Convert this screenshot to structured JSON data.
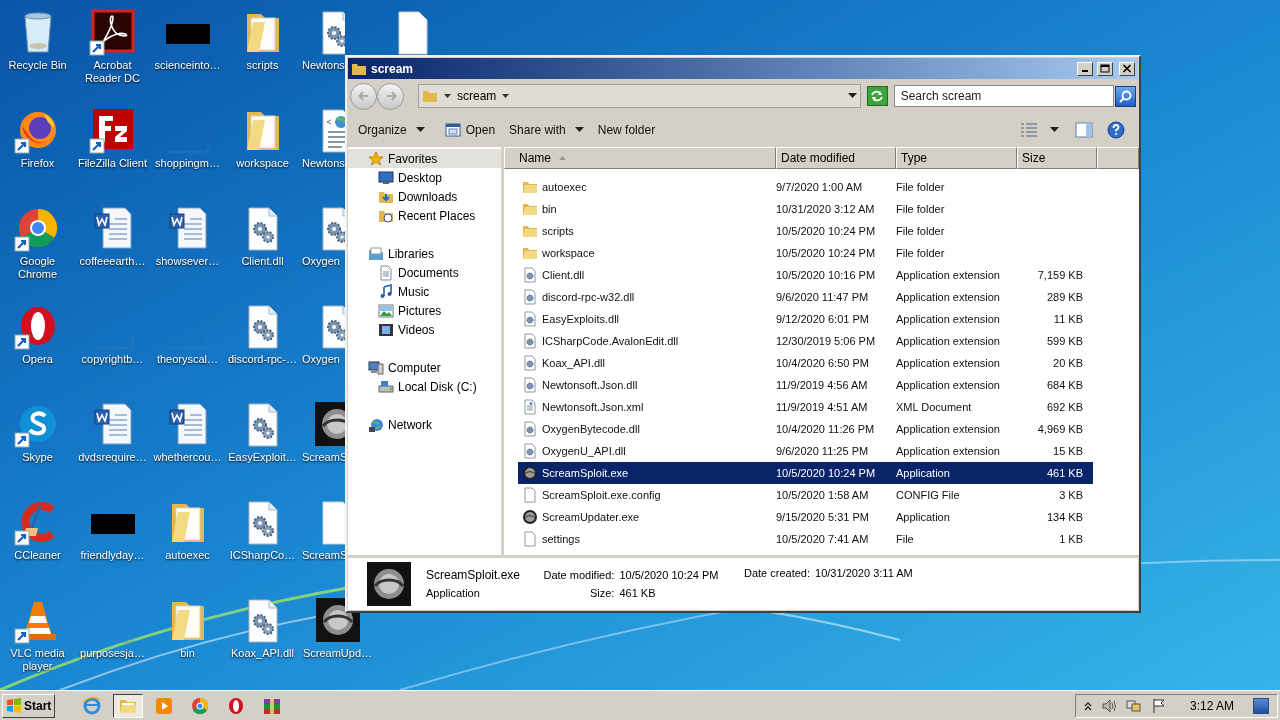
{
  "desktop": {
    "icons": [
      {
        "label": "Recycle Bin",
        "kind": "recycle",
        "shortcut": false
      },
      {
        "label": "Firefox",
        "kind": "firefox",
        "shortcut": true
      },
      {
        "label": "Google Chrome",
        "kind": "chrome",
        "shortcut": true
      },
      {
        "label": "Opera",
        "kind": "opera",
        "shortcut": true
      },
      {
        "label": "Skype",
        "kind": "skype",
        "shortcut": true
      },
      {
        "label": "CCleaner",
        "kind": "ccleaner",
        "shortcut": true
      },
      {
        "label": "VLC media player",
        "kind": "vlc",
        "shortcut": true
      },
      {
        "label": "Acrobat Reader DC",
        "kind": "acrobat",
        "shortcut": true
      },
      {
        "label": "FileZilla Client",
        "kind": "filezilla",
        "shortcut": true
      },
      {
        "label": "coffeeearth…",
        "kind": "word",
        "shortcut": false
      },
      {
        "label": "copyrightb…",
        "kind": "blank",
        "shortcut": false
      },
      {
        "label": "dvdsrequire…",
        "kind": "word",
        "shortcut": false
      },
      {
        "label": "friendlyday…",
        "kind": "redacted",
        "shortcut": false
      },
      {
        "label": "purposesja…",
        "kind": "blank",
        "shortcut": false
      },
      {
        "label": "scienceinto…",
        "kind": "redacted",
        "shortcut": false
      },
      {
        "label": "shoppingm…",
        "kind": "blank",
        "shortcut": false
      },
      {
        "label": "showsever…",
        "kind": "word",
        "shortcut": false
      },
      {
        "label": "theoryscal…",
        "kind": "blank",
        "shortcut": false
      },
      {
        "label": "whethercou…",
        "kind": "word",
        "shortcut": false
      },
      {
        "label": "autoexec",
        "kind": "folder",
        "shortcut": false
      },
      {
        "label": "bin",
        "kind": "folder",
        "shortcut": false
      },
      {
        "label": "scripts",
        "kind": "folder",
        "shortcut": false
      },
      {
        "label": "workspace",
        "kind": "folder",
        "shortcut": false
      },
      {
        "label": "Client.dll",
        "kind": "gear",
        "shortcut": false
      },
      {
        "label": "discord-rpc-…",
        "kind": "gear",
        "shortcut": false
      },
      {
        "label": "EasyExploit…",
        "kind": "gear",
        "shortcut": false
      },
      {
        "label": "ICSharpCo…",
        "kind": "gear",
        "shortcut": false
      },
      {
        "label": "Koax_API.dll",
        "kind": "gear",
        "shortcut": false
      },
      {
        "label": "Newtons",
        "kind": "gear",
        "shortcut": false
      },
      {
        "label": "Newtons",
        "kind": "xml",
        "shortcut": false
      },
      {
        "label": "Oxygen",
        "kind": "gear",
        "shortcut": false
      },
      {
        "label": "Oxygen",
        "kind": "gear",
        "shortcut": false
      },
      {
        "label": "ScreamS",
        "kind": "scream",
        "shortcut": false
      },
      {
        "label": "ScreamS",
        "kind": "page",
        "shortcut": false
      },
      {
        "label": "ScreamUpd…",
        "kind": "scream",
        "shortcut": false
      },
      {
        "kind": "page",
        "shortcut": false
      }
    ]
  },
  "window": {
    "title": "scream",
    "address": "scream",
    "search": {
      "placeholder": "Search scream"
    },
    "toolbar": [
      {
        "label": "Organize",
        "kind": "plain",
        "dropdown": true
      },
      {
        "label": "Open",
        "kind": "with-icon",
        "dropdown": false
      },
      {
        "label": "Share with",
        "kind": "plain",
        "dropdown": true
      },
      {
        "label": "New folder",
        "kind": "plain",
        "dropdown": false
      }
    ],
    "nav": [
      {
        "label": "Favorites",
        "kind": "star",
        "selected": true,
        "children": [
          {
            "label": "Desktop",
            "kind": "desktop",
            "selected": false
          },
          {
            "label": "Downloads",
            "kind": "downloads",
            "selected": false
          },
          {
            "label": "Recent Places",
            "kind": "recent",
            "selected": false
          }
        ]
      },
      {
        "label": "Libraries",
        "kind": "library",
        "selected": false,
        "children": [
          {
            "label": "Documents",
            "kind": "documents",
            "selected": false
          },
          {
            "label": "Music",
            "kind": "music",
            "selected": false
          },
          {
            "label": "Pictures",
            "kind": "pictures",
            "selected": false
          },
          {
            "label": "Videos",
            "kind": "videos",
            "selected": false
          }
        ]
      },
      {
        "label": "Computer",
        "kind": "computer",
        "selected": false,
        "children": [
          {
            "label": "Local Disk (C:)",
            "kind": "disk",
            "selected": false
          }
        ]
      },
      {
        "label": "Network",
        "kind": "network",
        "selected": false
      }
    ],
    "columns": [
      {
        "label": "Name",
        "sorted": true
      },
      {
        "label": "Date modified",
        "sorted": false
      },
      {
        "label": "Type",
        "sorted": false
      },
      {
        "label": "Size",
        "sorted": false
      }
    ],
    "rows": [
      {
        "name": "autoexec",
        "date": "9/7/2020 1:00 AM",
        "type": "File folder",
        "kind": "folder",
        "selected": false
      },
      {
        "name": "bin",
        "date": "10/31/2020 3:12 AM",
        "type": "File folder",
        "kind": "folder",
        "selected": false
      },
      {
        "name": "scripts",
        "date": "10/5/2020 10:24 PM",
        "type": "File folder",
        "kind": "folder",
        "selected": false
      },
      {
        "name": "workspace",
        "date": "10/5/2020 10:24 PM",
        "type": "File folder",
        "kind": "folder",
        "selected": false
      },
      {
        "name": "Client.dll",
        "date": "10/5/2020 10:16 PM",
        "type": "Application extension",
        "size": "7,159 KB",
        "kind": "dll",
        "selected": false
      },
      {
        "name": "discord-rpc-w32.dll",
        "date": "9/6/2020 11:47 PM",
        "type": "Application extension",
        "size": "289 KB",
        "kind": "dll",
        "selected": false
      },
      {
        "name": "EasyExploits.dll",
        "date": "9/12/2020 6:01 PM",
        "type": "Application extension",
        "size": "11 KB",
        "kind": "dll",
        "selected": false
      },
      {
        "name": "ICSharpCode.AvalonEdit.dll",
        "date": "12/30/2019 5:06 PM",
        "type": "Application extension",
        "size": "599 KB",
        "kind": "dll",
        "selected": false
      },
      {
        "name": "Koax_API.dll",
        "date": "10/4/2020 6:50 PM",
        "type": "Application extension",
        "size": "20 KB",
        "kind": "dll",
        "selected": false
      },
      {
        "name": "Newtonsoft.Json.dll",
        "date": "11/9/2019 4:56 AM",
        "type": "Application extension",
        "size": "684 KB",
        "kind": "dll",
        "selected": false
      },
      {
        "name": "Newtonsoft.Json.xml",
        "date": "11/9/2019 4:51 AM",
        "type": "XML Document",
        "size": "692 KB",
        "kind": "xml",
        "selected": false
      },
      {
        "name": "OxygenBytecode.dll",
        "date": "10/4/2020 11:26 PM",
        "type": "Application extension",
        "size": "4,969 KB",
        "kind": "dll",
        "selected": false
      },
      {
        "name": "OxygenU_API.dll",
        "date": "9/6/2020 11:25 PM",
        "type": "Application extension",
        "size": "15 KB",
        "kind": "dll",
        "selected": false
      },
      {
        "name": "ScreamSploit.exe",
        "date": "10/5/2020 10:24 PM",
        "type": "Application",
        "size": "461 KB",
        "kind": "exe",
        "selected": true
      },
      {
        "name": "ScreamSploit.exe.config",
        "date": "10/5/2020 1:58 AM",
        "type": "CONFIG File",
        "size": "3 KB",
        "kind": "file",
        "selected": false
      },
      {
        "name": "ScreamUpdater.exe",
        "date": "9/15/2020 5:31 PM",
        "type": "Application",
        "size": "134 KB",
        "kind": "exe",
        "selected": false
      },
      {
        "name": "settings",
        "date": "10/5/2020 7:41 AM",
        "type": "File",
        "size": "1 KB",
        "kind": "file",
        "selected": false
      }
    ],
    "details": {
      "name": "ScreamSploit.exe",
      "type": "Application",
      "fields": [
        {
          "label": "Date modified:",
          "value": "10/5/2020 10:24 PM"
        },
        {
          "label": "Size:",
          "value": "461 KB"
        },
        {
          "label": "Date created:",
          "value": "10/31/2020 3:11 AM"
        }
      ]
    }
  },
  "taskbar": {
    "start": "Start",
    "apps": [
      {
        "kind": "ie",
        "active": false
      },
      {
        "kind": "explorer",
        "active": true
      },
      {
        "kind": "media",
        "active": false
      },
      {
        "kind": "chrome",
        "active": false
      },
      {
        "kind": "opera",
        "active": false
      },
      {
        "kind": "winrar",
        "active": false
      }
    ],
    "time": "3:12 AM"
  }
}
